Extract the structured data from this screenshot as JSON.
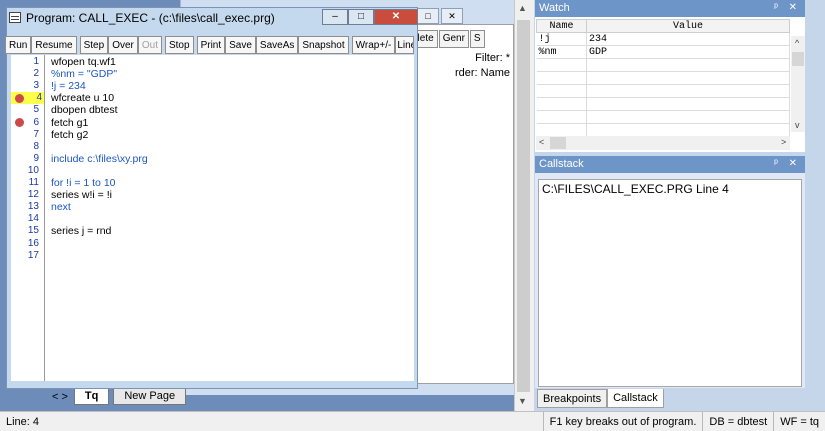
{
  "program_window": {
    "title": "Program: CALL_EXEC - (c:\\files\\call_exec.prg)",
    "controls": {
      "minimize": "‒",
      "maximize": "□",
      "close": "✕"
    },
    "toolbar": [
      "Run",
      "Resume",
      "Step",
      "Over",
      "Out",
      "Stop",
      "Print",
      "Save",
      "SaveAs",
      "Snapshot",
      "Wrap+/-",
      "Line"
    ],
    "disabled_buttons": [
      "Out"
    ],
    "line_numbers": [
      "1",
      "2",
      "3",
      "4",
      "5",
      "6",
      "7",
      "8",
      "9",
      "10",
      "11",
      "12",
      "13",
      "14",
      "15",
      "16",
      "17"
    ],
    "current_line": 4,
    "breakpoint_lines": [
      4,
      6
    ],
    "code_lines": [
      "wfopen tq.wf1",
      "%nm = \"GDP\"",
      "!j = 234",
      "wfcreate u 10",
      "dbopen dbtest",
      "fetch g1",
      "fetch g2",
      "",
      "include c:\\files\\xy.prg",
      "",
      "for !i = 1 to 10",
      "series w!i = !i",
      "next",
      "",
      "series j = rnd",
      "",
      ""
    ]
  },
  "background_window": {
    "toolbar": [
      "elete",
      "Genr",
      "S"
    ],
    "filter_text": "Filter: *",
    "order_text": "rder: Name",
    "controls": {
      "restore": "□",
      "close": "✕"
    }
  },
  "sheet_tabs": {
    "nav": "< >",
    "tabs": [
      "Tq",
      "New Page"
    ]
  },
  "watch": {
    "title": "Watch",
    "pins": "ᵖ ✕",
    "columns": [
      "Name",
      "Value"
    ],
    "rows": [
      {
        "name": "!j",
        "value": "234"
      },
      {
        "name": "%nm",
        "value": "GDP"
      }
    ]
  },
  "callstack": {
    "title": "Callstack",
    "pins": "ᵖ ✕",
    "entry": "C:\\FILES\\CALL_EXEC.PRG Line 4"
  },
  "panel_tabs": [
    "Breakpoints",
    "Callstack"
  ],
  "statusbar": {
    "line": "Line: 4",
    "hint": "F1 key breaks out of program.",
    "db": "DB = dbtest",
    "wf": "WF = tq"
  }
}
